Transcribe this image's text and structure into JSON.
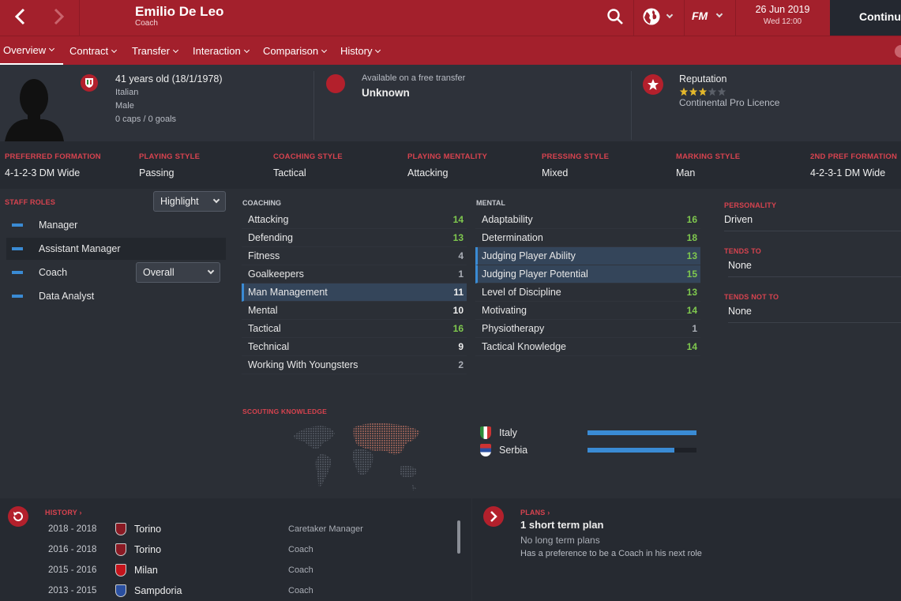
{
  "header": {
    "name": "Emilio De Leo",
    "role": "Coach",
    "date": "26 Jun 2019",
    "time": "Wed 12:00",
    "continue_label": "Continue",
    "fm_logo": "FM"
  },
  "tabs": [
    {
      "label": "Overview"
    },
    {
      "label": "Contract"
    },
    {
      "label": "Transfer"
    },
    {
      "label": "Interaction"
    },
    {
      "label": "Comparison"
    },
    {
      "label": "History"
    }
  ],
  "profile": {
    "age": "41 years old (18/1/1978)",
    "nationality": "Italian",
    "gender": "Male",
    "caps": "0 caps / 0 goals",
    "transfer_status": "Available on a free transfer",
    "transfer_value": "Unknown",
    "reputation_label": "Reputation",
    "reputation_stars": 3,
    "reputation_max": 5,
    "licence": "Continental Pro Licence"
  },
  "styles": [
    {
      "label": "Preferred Formation",
      "value": "4-1-2-3 DM Wide"
    },
    {
      "label": "Playing Style",
      "value": "Passing"
    },
    {
      "label": "Coaching Style",
      "value": "Tactical"
    },
    {
      "label": "Playing Mentality",
      "value": "Attacking"
    },
    {
      "label": "Pressing Style",
      "value": "Mixed"
    },
    {
      "label": "Marking Style",
      "value": "Man"
    },
    {
      "label": "2nd Pref Formation",
      "value": "4-2-3-1 DM Wide"
    }
  ],
  "staff_roles": {
    "title": "Staff Roles",
    "highlight_label": "Highlight",
    "overall_label": "Overall",
    "roles": [
      "Manager",
      "Assistant Manager",
      "Coach",
      "Data Analyst"
    ]
  },
  "coaching": {
    "title": "Coaching",
    "attrs": [
      {
        "name": "Attacking",
        "value": "14"
      },
      {
        "name": "Defending",
        "value": "13"
      },
      {
        "name": "Fitness",
        "value": "4"
      },
      {
        "name": "Goalkeepers",
        "value": "1"
      },
      {
        "name": "Man Management",
        "value": "11"
      },
      {
        "name": "Mental",
        "value": "10"
      },
      {
        "name": "Tactical",
        "value": "16"
      },
      {
        "name": "Technical",
        "value": "9"
      },
      {
        "name": "Working With Youngsters",
        "value": "2"
      }
    ]
  },
  "mental": {
    "title": "Mental",
    "attrs": [
      {
        "name": "Adaptability",
        "value": "16"
      },
      {
        "name": "Determination",
        "value": "18"
      },
      {
        "name": "Judging Player Ability",
        "value": "13"
      },
      {
        "name": "Judging Player Potential",
        "value": "15"
      },
      {
        "name": "Level of Discipline",
        "value": "13"
      },
      {
        "name": "Motivating",
        "value": "14"
      },
      {
        "name": "Physiotherapy",
        "value": "1"
      },
      {
        "name": "Tactical Knowledge",
        "value": "14"
      }
    ]
  },
  "personality": {
    "personality_label": "Personality",
    "personality_value": "Driven",
    "tends_to_label": "Tends To",
    "tends_to_value": "None",
    "tends_not_to_label": "Tends Not To",
    "tends_not_to_value": "None"
  },
  "scouting": {
    "title": "Scouting Knowledge",
    "countries": [
      {
        "name": "Italy",
        "level": 1.0
      },
      {
        "name": "Serbia",
        "level": 0.8
      }
    ]
  },
  "history": {
    "title": "History",
    "rows": [
      {
        "years": "2018 - 2018",
        "club": "Torino",
        "role": "Caretaker Manager"
      },
      {
        "years": "2016 - 2018",
        "club": "Torino",
        "role": "Coach"
      },
      {
        "years": "2015 - 2016",
        "club": "Milan",
        "role": "Coach"
      },
      {
        "years": "2013 - 2015",
        "club": "Sampdoria",
        "role": "Coach"
      }
    ]
  },
  "plans": {
    "title": "Plans",
    "short_term": "1 short term plan",
    "long_term": "No long term plans",
    "preference": "Has a preference to be a Coach in his next role"
  },
  "colors": {
    "brand_red": "#a3202c",
    "accent_blue": "#3a8bd4",
    "good_green": "#7fc84e",
    "star_gold": "#e3b72b"
  }
}
